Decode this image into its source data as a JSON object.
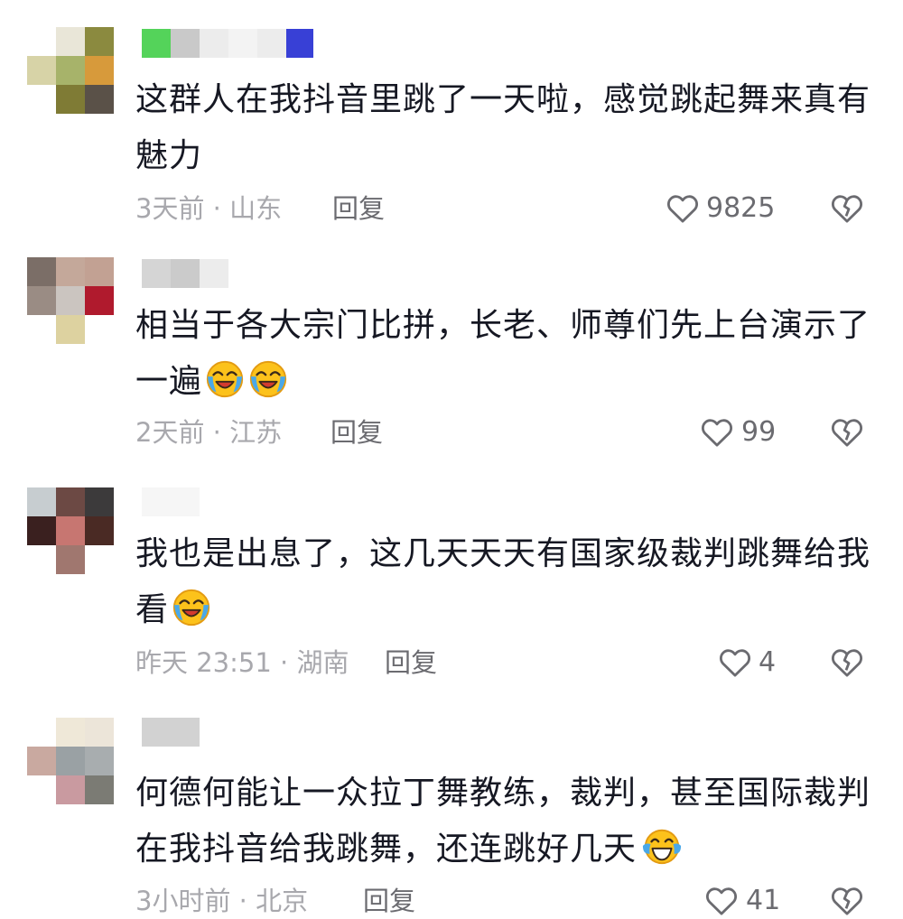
{
  "comments": [
    {
      "text": "这群人在我抖音里跳了一天啦，感觉跳起舞来真有魅力",
      "time_location": "3天前 · 山东",
      "reply_label": "回复",
      "likes": "9825",
      "emoji": []
    },
    {
      "text": "相当于各大宗门比拼，长老、师尊们先上台演示了一遍",
      "time_location": "2天前 · 江苏",
      "reply_label": "回复",
      "likes": "99",
      "emoji": [
        "crying-laughing",
        "crying-laughing"
      ]
    },
    {
      "text": "我也是出息了，这几天天天有国家级裁判跳舞给我看",
      "time_location": "昨天 23:51 · 湖南",
      "reply_label": "回复",
      "likes": "4",
      "emoji": [
        "crying-laughing"
      ]
    },
    {
      "text": "何德何能让一众拉丁舞教练，裁判，甚至国际裁判在我抖音给我跳舞，还连跳好几天",
      "time_location": "3小时前 · 北京",
      "reply_label": "回复",
      "likes": "41",
      "emoji": [
        "tears-of-joy"
      ]
    }
  ],
  "icons": {
    "like": "heart-outline-icon",
    "dislike": "broken-heart-icon"
  },
  "colors": {
    "text": "#161823",
    "meta": "#a8a8ad",
    "action": "#6b6b70"
  }
}
